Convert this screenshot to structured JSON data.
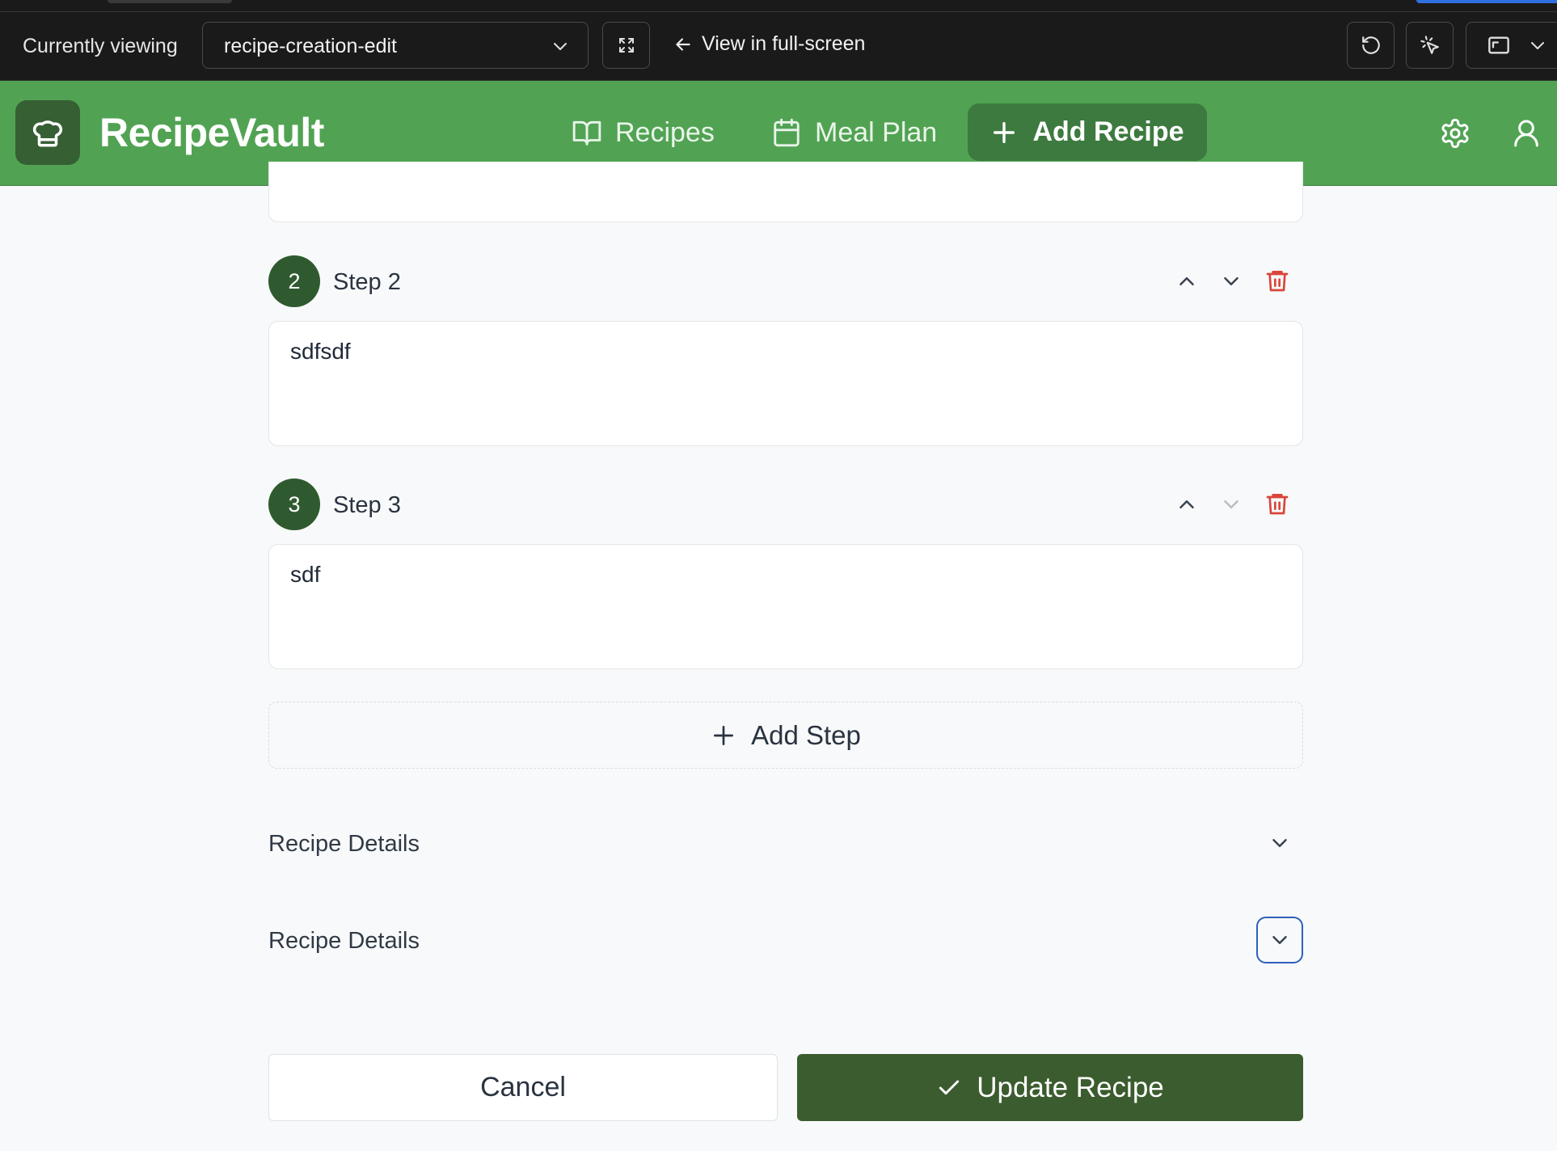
{
  "preview_toolbar": {
    "currently_viewing_label": "Currently viewing",
    "selected_view": "recipe-creation-edit",
    "fullscreen_link": "View in full-screen",
    "icons": [
      "expand-icon",
      "arrow-left-icon",
      "refresh-icon",
      "cursor-click-icon",
      "window-icon",
      "chevron-down-icon"
    ]
  },
  "header": {
    "brand": "RecipeVault",
    "nav": {
      "recipes": "Recipes",
      "meal_plan": "Meal Plan",
      "add_recipe": "Add Recipe"
    },
    "colors": {
      "header_bg": "#51a353",
      "accent_dark": "#3d7a3f",
      "logo_bg": "#365f34"
    },
    "icons": [
      "chef-hat-icon",
      "book-open-icon",
      "calendar-icon",
      "plus-icon",
      "gear-icon",
      "user-icon"
    ]
  },
  "steps": [
    {
      "number": "2",
      "title": "Step 2",
      "text": "sdfsdf",
      "move_down_enabled": true
    },
    {
      "number": "3",
      "title": "Step 3",
      "text": "sdf",
      "move_down_enabled": false
    }
  ],
  "add_step_label": "Add Step",
  "sections": [
    {
      "title": "Recipe Details",
      "focused": false
    },
    {
      "title": "Recipe Details",
      "focused": true
    }
  ],
  "actions": {
    "cancel": "Cancel",
    "update": "Update Recipe"
  },
  "colors": {
    "step_badge": "#2f5a2f",
    "delete_icon": "#d9453a",
    "update_button": "#3b5c2e",
    "focus_ring": "#2f5fbd"
  }
}
